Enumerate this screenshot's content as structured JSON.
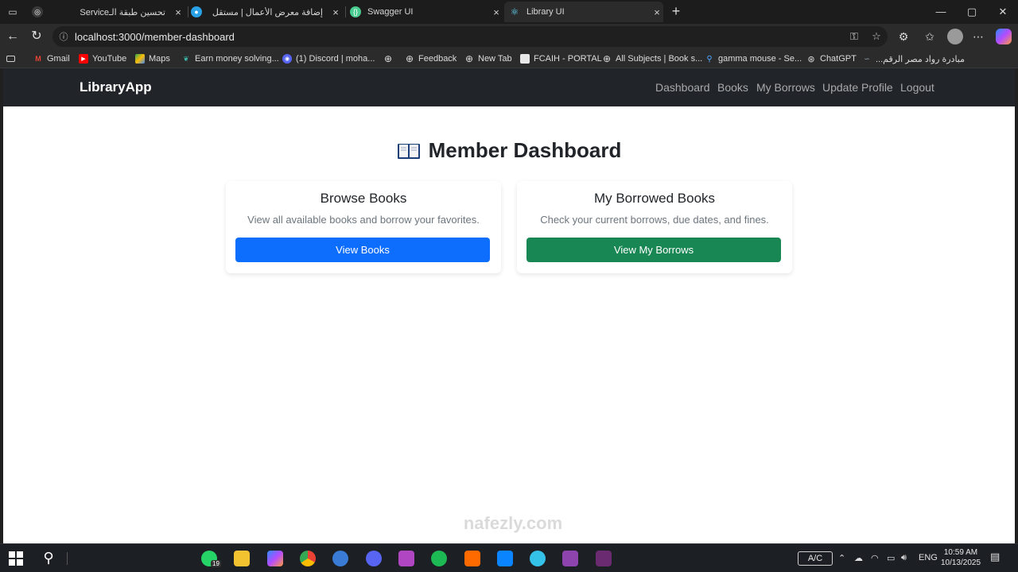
{
  "browser": {
    "tabs": [
      {
        "title": "تحسين طبقة الـService",
        "active": false
      },
      {
        "title": "إضافة معرض الأعمال | مستقل",
        "active": false
      },
      {
        "title": "Swagger UI",
        "active": false
      },
      {
        "title": "Library UI",
        "active": true
      }
    ],
    "url": "localhost:3000/member-dashboard",
    "bookmarks": [
      "Gmail",
      "YouTube",
      "Maps",
      "Earn money solving...",
      "(1) Discord | moha...",
      "Feedback",
      "New Tab",
      "FCAIH - PORTAL",
      "All Subjects | Book s...",
      "gamma mouse - Se...",
      "ChatGPT",
      "مبادرة رواد مصر الرقم..."
    ]
  },
  "app": {
    "brand": "LibraryApp",
    "nav": [
      "Dashboard",
      "Books",
      "My Borrows",
      "Update Profile",
      "Logout"
    ],
    "page_title": "Member Dashboard",
    "cards": [
      {
        "title": "Browse Books",
        "description": "View all available books and borrow your favorites.",
        "button": "View Books",
        "button_color": "#0d6efd"
      },
      {
        "title": "My Borrowed Books",
        "description": "Check your current borrows, due dates, and fines.",
        "button": "View My Borrows",
        "button_color": "#198754"
      }
    ]
  },
  "watermark": "nafezly.com",
  "taskbar": {
    "whatsapp_badge": "19",
    "keyboard": "A/C",
    "language": "ENG",
    "time": "10:59 AM",
    "date": "10/13/2025"
  }
}
